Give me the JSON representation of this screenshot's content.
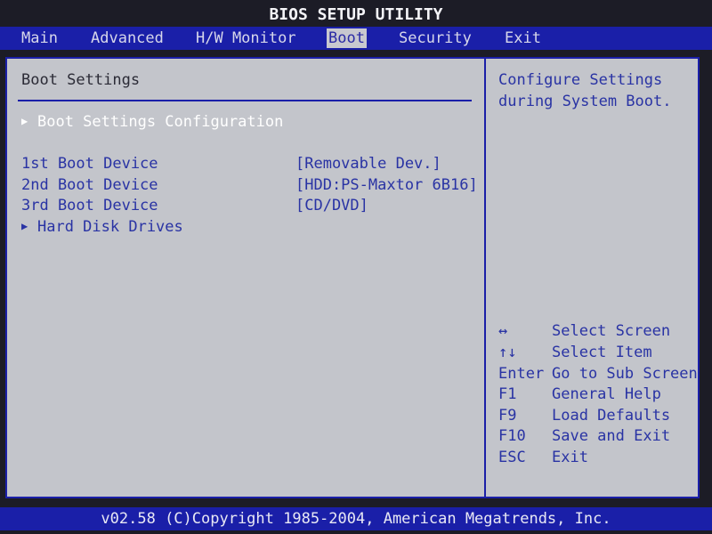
{
  "title": "BIOS SETUP UTILITY",
  "tabs": [
    {
      "label": "Main"
    },
    {
      "label": "Advanced"
    },
    {
      "label": "H/W Monitor"
    },
    {
      "label": "Boot"
    },
    {
      "label": "Security"
    },
    {
      "label": "Exit"
    }
  ],
  "active_tab": "Boot",
  "section_title": "Boot Settings",
  "submenu_configuration": "Boot Settings Configuration",
  "boot_items": [
    {
      "label": "1st Boot Device",
      "value": "[Removable Dev.]"
    },
    {
      "label": "2nd Boot Device",
      "value": "[HDD:PS-Maxtor 6B16]"
    },
    {
      "label": "3rd Boot Device",
      "value": "[CD/DVD]"
    }
  ],
  "hard_disk_drives": "Hard Disk Drives",
  "help_text": "Configure Settings during System Boot.",
  "keys": [
    {
      "key": "↔",
      "action": "Select Screen"
    },
    {
      "key": "↑↓",
      "action": "Select Item"
    },
    {
      "key": "Enter",
      "action": "Go to Sub Screen"
    },
    {
      "key": "F1",
      "action": "General Help"
    },
    {
      "key": "F9",
      "action": "Load Defaults"
    },
    {
      "key": "F10",
      "action": "Save and Exit"
    },
    {
      "key": "ESC",
      "action": "Exit"
    }
  ],
  "footer": "v02.58 (C)Copyright 1985-2004, American Megatrends, Inc.",
  "colors": {
    "frame": "#1a1fa8",
    "panel": "#c3c5cb",
    "text": "#2933a4",
    "highlight": "#ffffff"
  }
}
